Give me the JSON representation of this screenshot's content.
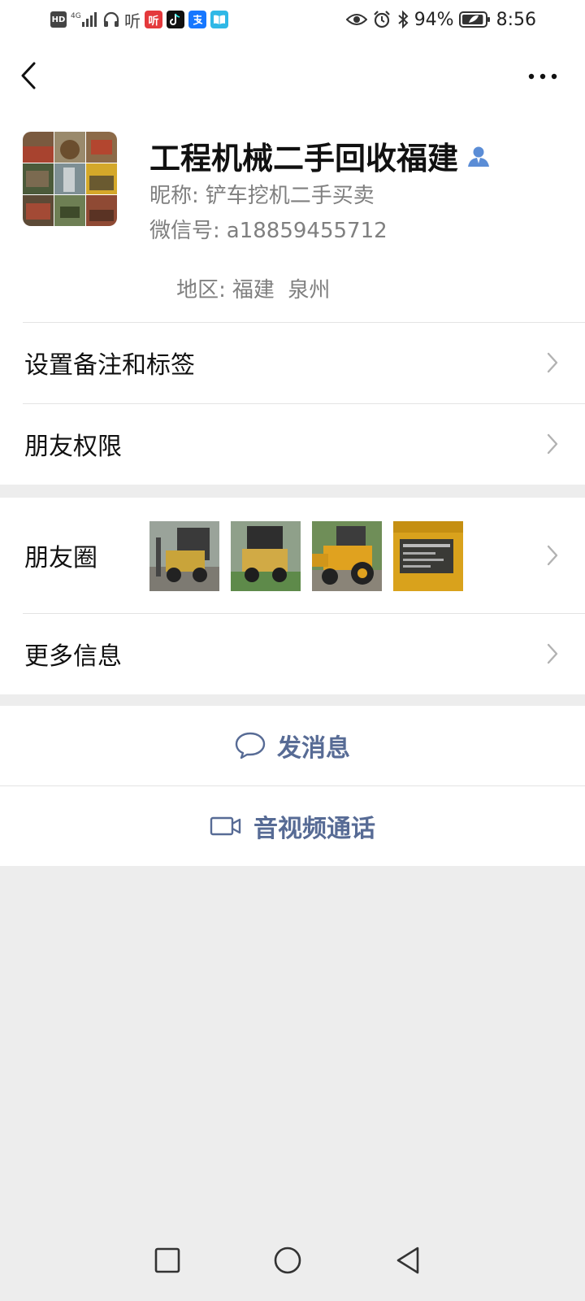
{
  "status_bar": {
    "left_icons": [
      "hd-icon",
      "signal-4g-icon",
      "headphones-icon",
      "ting-icon",
      "ting-app-icon",
      "tiktok-icon",
      "alipay-icon",
      "reader-icon"
    ],
    "hd_badge": "HD",
    "ting_text": "听",
    "ting_app_text": "听",
    "battery_percent": "94%",
    "time": "8:56",
    "battery_level": 0.94
  },
  "profile": {
    "name": "工程机械二手回收福建",
    "nickname_label": "昵称:",
    "nickname": "铲车挖机二手买卖",
    "wechat_id_label": "微信号:",
    "wechat_id": "a18859455712",
    "region_label": "地区:",
    "region": "福建  泉州"
  },
  "menu": {
    "remark_tags": "设置备注和标签",
    "friend_permissions": "朋友权限",
    "moments": "朋友圈",
    "more_info": "更多信息"
  },
  "actions": {
    "send_message": "发消息",
    "av_call": "音视频通话"
  },
  "colors": {
    "link": "#576b95",
    "background": "#ededed",
    "verified": "#5b8dd6"
  }
}
